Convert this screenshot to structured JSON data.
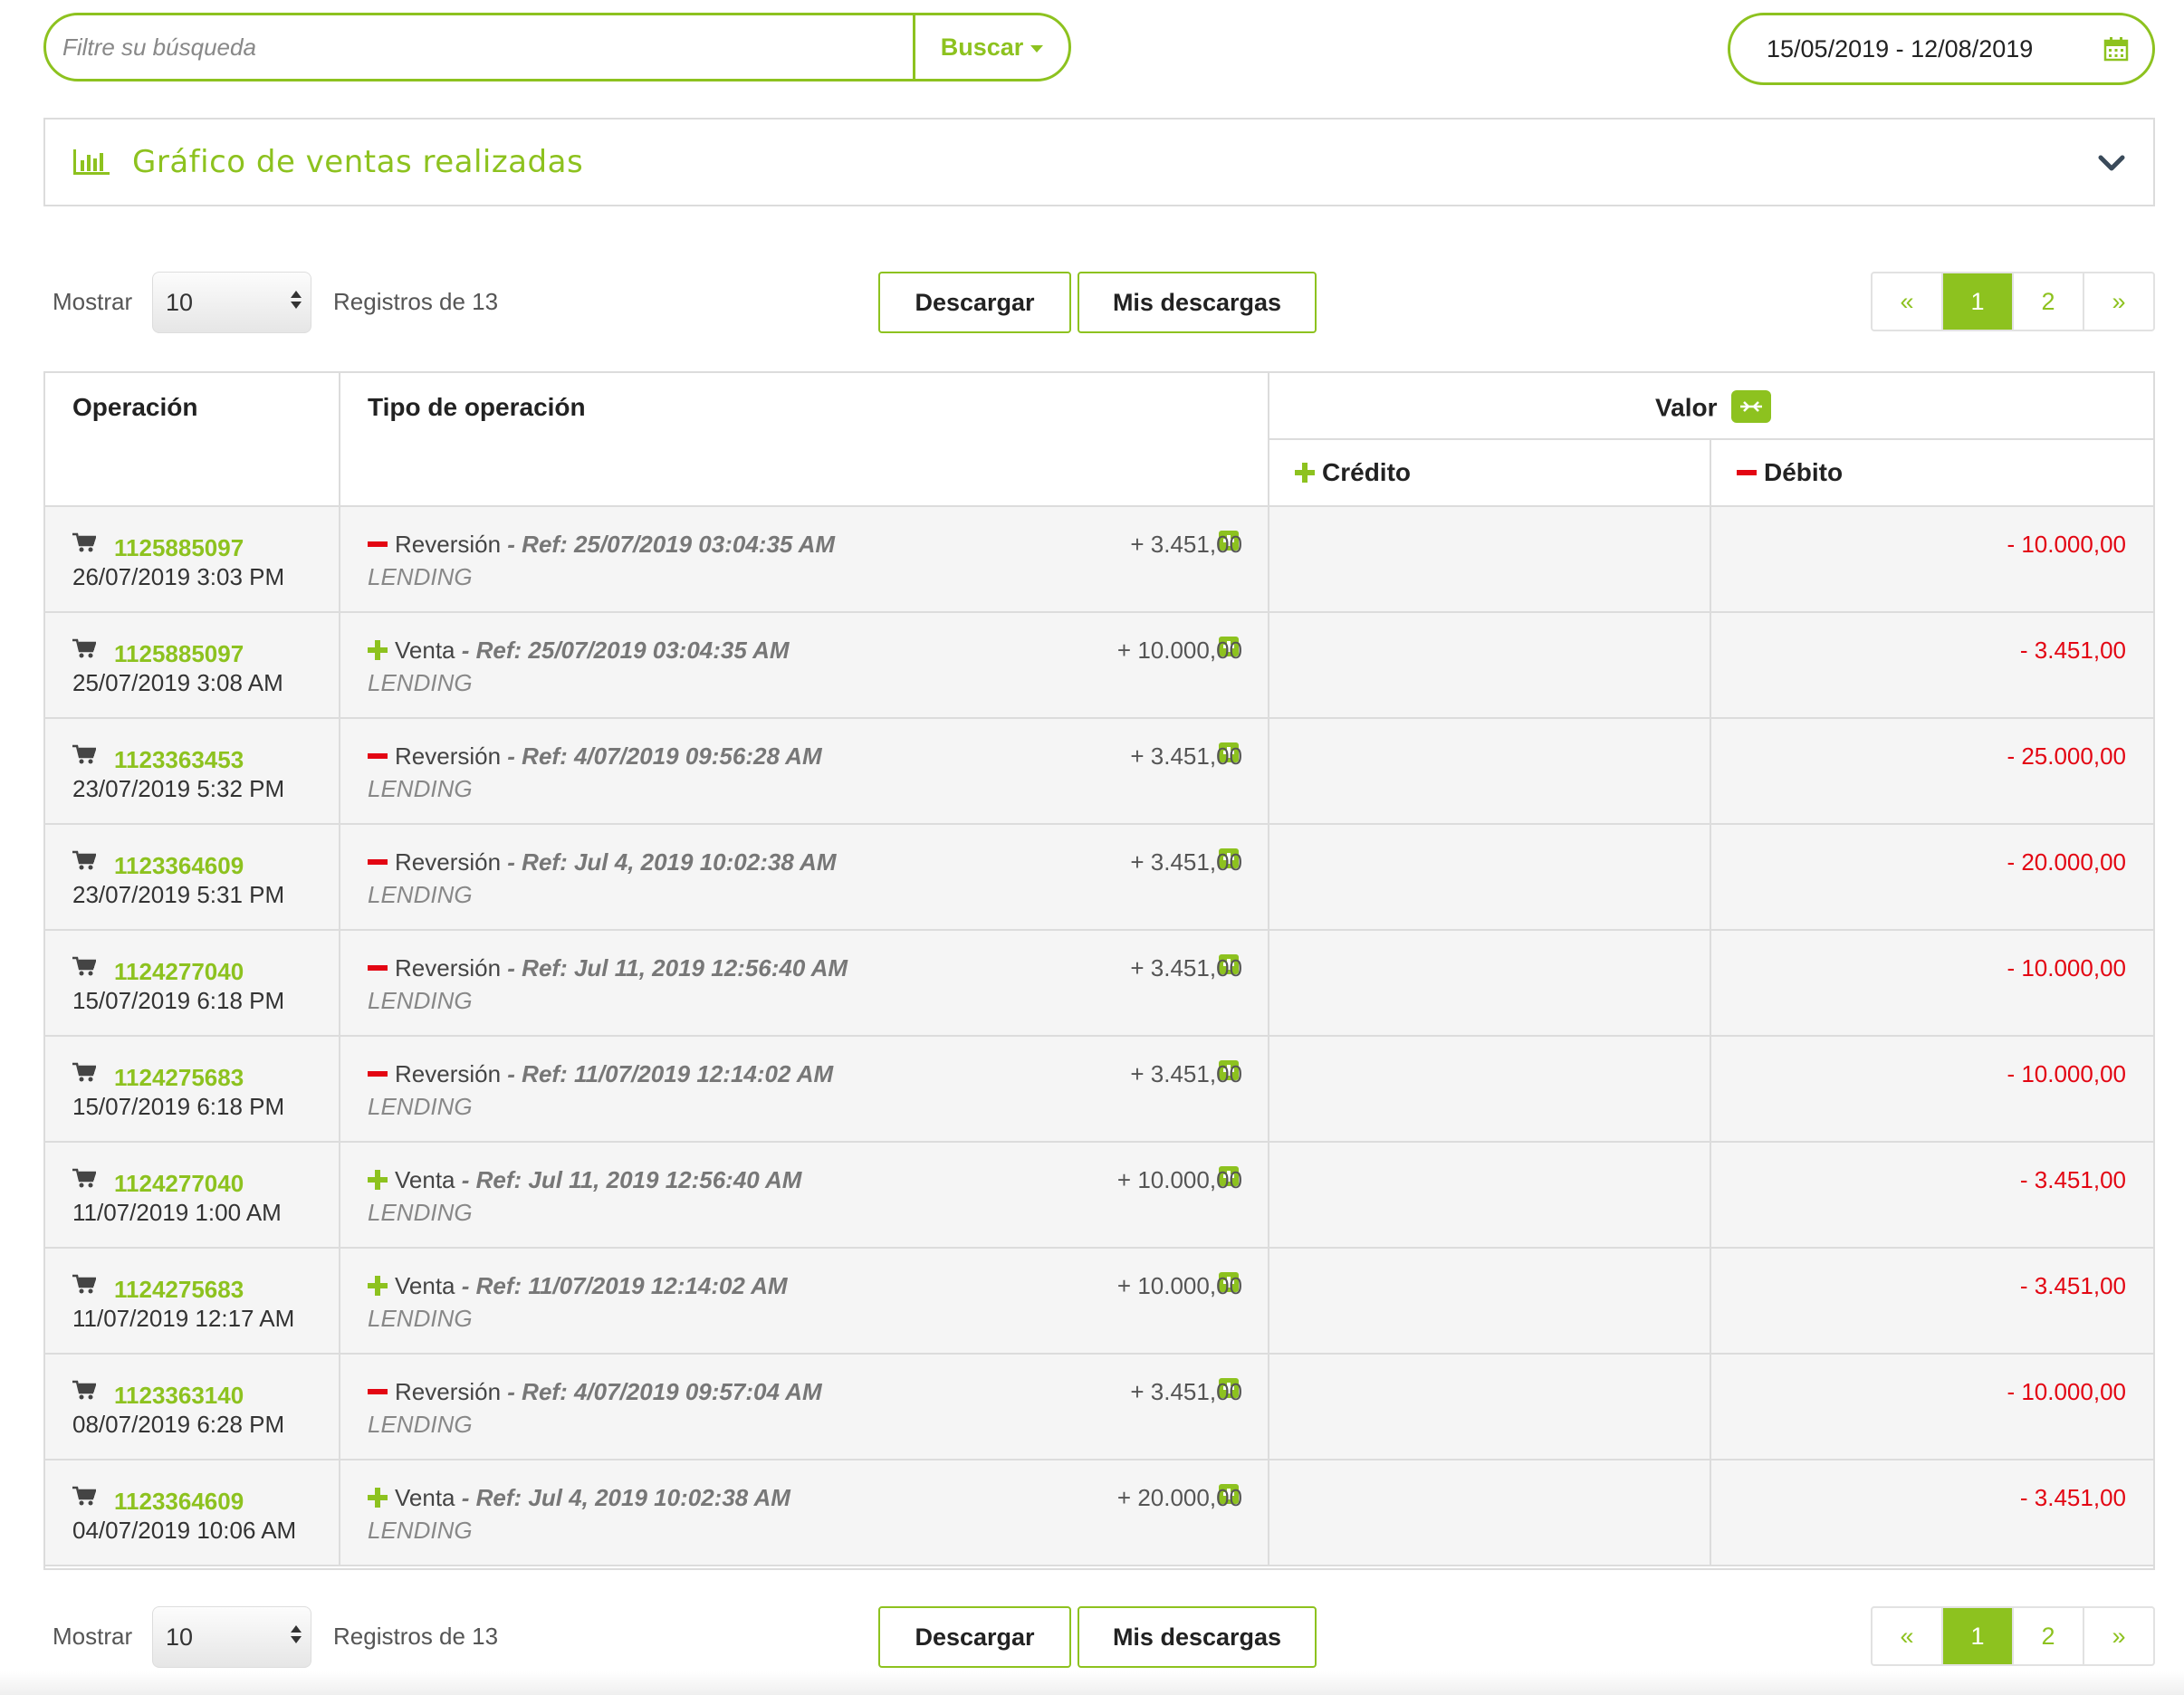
{
  "search": {
    "placeholder": "Filtre su búsqueda",
    "button_label": "Buscar"
  },
  "date_range": {
    "value": "15/05/2019 - 12/08/2019"
  },
  "chart_panel": {
    "title": "Gráfico de ventas realizadas"
  },
  "controls": {
    "mostrar_label": "Mostrar",
    "page_size": "10",
    "registros_text": "Registros de 13",
    "download_label": "Descargar",
    "my_downloads_label": "Mis descargas",
    "pager": {
      "prev": "«",
      "pages": [
        "1",
        "2"
      ],
      "next": "»",
      "active_page": "1"
    }
  },
  "table": {
    "headers": {
      "operacion": "Operación",
      "tipo": "Tipo de operación",
      "valor": "Valor",
      "credito": "Crédito",
      "debito": "Débito"
    },
    "rows": [
      {
        "id": "1125885097",
        "date": "26/07/2019 3:03 PM",
        "sign": "minus",
        "type": "Reversión",
        "ref": " - Ref: 25/07/2019 03:04:35 AM",
        "channel": "LENDING",
        "credit": "+ 3.451,00",
        "debit": "- 10.000,00"
      },
      {
        "id": "1125885097",
        "date": "25/07/2019 3:08 AM",
        "sign": "plus",
        "type": "Venta",
        "ref": " - Ref: 25/07/2019 03:04:35 AM",
        "channel": "LENDING",
        "credit": "+ 10.000,00",
        "debit": "- 3.451,00"
      },
      {
        "id": "1123363453",
        "date": "23/07/2019 5:32 PM",
        "sign": "minus",
        "type": "Reversión",
        "ref": " - Ref: 4/07/2019 09:56:28 AM",
        "channel": "LENDING",
        "credit": "+ 3.451,00",
        "debit": "- 25.000,00"
      },
      {
        "id": "1123364609",
        "date": "23/07/2019 5:31 PM",
        "sign": "minus",
        "type": "Reversión",
        "ref": " - Ref: Jul 4, 2019 10:02:38 AM",
        "channel": "LENDING",
        "credit": "+ 3.451,00",
        "debit": "- 20.000,00"
      },
      {
        "id": "1124277040",
        "date": "15/07/2019 6:18 PM",
        "sign": "minus",
        "type": "Reversión",
        "ref": " - Ref: Jul 11, 2019 12:56:40 AM",
        "channel": "LENDING",
        "credit": "+ 3.451,00",
        "debit": "- 10.000,00"
      },
      {
        "id": "1124275683",
        "date": "15/07/2019 6:18 PM",
        "sign": "minus",
        "type": "Reversión",
        "ref": " - Ref: 11/07/2019 12:14:02 AM",
        "channel": "LENDING",
        "credit": "+ 3.451,00",
        "debit": "- 10.000,00"
      },
      {
        "id": "1124277040",
        "date": "11/07/2019 1:00 AM",
        "sign": "plus",
        "type": "Venta",
        "ref": " - Ref: Jul 11, 2019 12:56:40 AM",
        "channel": "LENDING",
        "credit": "+ 10.000,00",
        "debit": "- 3.451,00"
      },
      {
        "id": "1124275683",
        "date": "11/07/2019 12:17 AM",
        "sign": "plus",
        "type": "Venta",
        "ref": " - Ref: 11/07/2019 12:14:02 AM",
        "channel": "LENDING",
        "credit": "+ 10.000,00",
        "debit": "- 3.451,00"
      },
      {
        "id": "1123363140",
        "date": "08/07/2019 6:28 PM",
        "sign": "minus",
        "type": "Reversión",
        "ref": " - Ref: 4/07/2019 09:57:04 AM",
        "channel": "LENDING",
        "credit": "+ 3.451,00",
        "debit": "- 10.000,00"
      },
      {
        "id": "1123364609",
        "date": "04/07/2019 10:06 AM",
        "sign": "plus",
        "type": "Venta",
        "ref": " - Ref: Jul 4, 2019 10:02:38 AM",
        "channel": "LENDING",
        "credit": "+ 20.000,00",
        "debit": "- 3.451,00"
      }
    ]
  },
  "colors": {
    "accent": "#8dc21f",
    "debit": "#e30613",
    "border": "#dcdcdc",
    "row_bg": "#f5f5f5"
  },
  "icons": [
    "calendar-icon",
    "bar-chart-icon",
    "chevron-down-icon",
    "cart-icon",
    "expand-plus-icon",
    "swap-icon",
    "plus-icon",
    "minus-icon"
  ]
}
